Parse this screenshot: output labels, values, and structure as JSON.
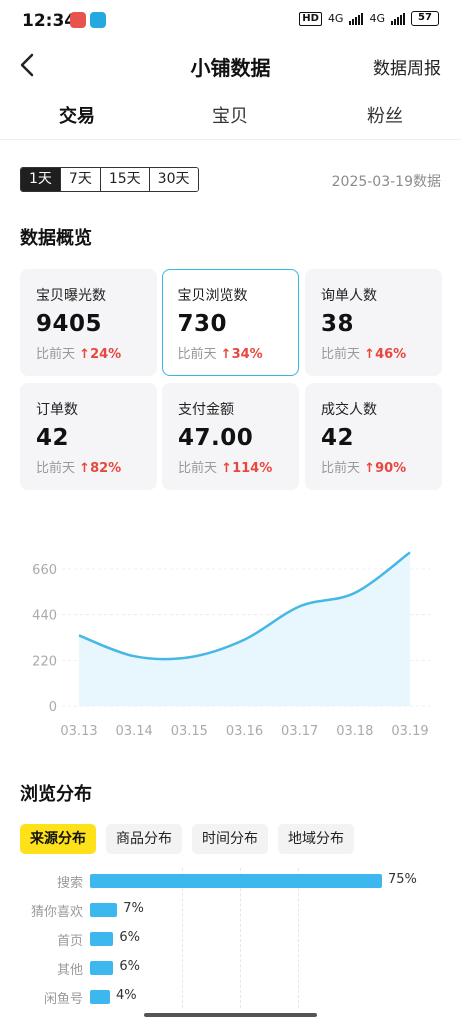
{
  "status": {
    "time": "12:34",
    "hd": "HD",
    "net1": "4G",
    "net2": "4G",
    "battery": "57"
  },
  "nav": {
    "title": "小铺数据",
    "right_link": "数据周报"
  },
  "tabs": [
    {
      "label": "交易",
      "active": true
    },
    {
      "label": "宝贝",
      "active": false
    },
    {
      "label": "粉丝",
      "active": false
    }
  ],
  "range": {
    "options": [
      "1天",
      "7天",
      "15天",
      "30天"
    ],
    "selected": "1天",
    "date_label": "2025-03-19数据"
  },
  "overview": {
    "title": "数据概览",
    "cards": [
      {
        "label": "宝贝曝光数",
        "value": "9405",
        "change_prefix": "比前天",
        "change": "24%"
      },
      {
        "label": "宝贝浏览数",
        "value": "730",
        "change_prefix": "比前天",
        "change": "34%"
      },
      {
        "label": "询单人数",
        "value": "38",
        "change_prefix": "比前天",
        "change": "46%"
      },
      {
        "label": "订单数",
        "value": "42",
        "change_prefix": "比前天",
        "change": "82%"
      },
      {
        "label": "支付金额",
        "value": "47.00",
        "change_prefix": "比前天",
        "change": "114%"
      },
      {
        "label": "成交人数",
        "value": "42",
        "change_prefix": "比前天",
        "change": "90%"
      }
    ],
    "selected_card": "宝贝浏览数"
  },
  "chart_data": {
    "type": "area",
    "x": [
      "03.13",
      "03.14",
      "03.15",
      "03.16",
      "03.17",
      "03.18",
      "03.19"
    ],
    "series": [
      {
        "values": [
          340,
          240,
          235,
          320,
          480,
          545,
          740
        ]
      }
    ],
    "ylim": [
      0,
      660
    ],
    "yticks": [
      0,
      220,
      440,
      660
    ],
    "grid": true,
    "line_color": "#45b8e5",
    "fill_color": "#e8f6fd"
  },
  "browse": {
    "title": "浏览分布",
    "subtabs": [
      {
        "label": "来源分布",
        "active": true
      },
      {
        "label": "商品分布",
        "active": false
      },
      {
        "label": "时间分布",
        "active": false
      },
      {
        "label": "地域分布",
        "active": false
      }
    ],
    "rows": [
      {
        "label": "搜索",
        "percent": 75,
        "text": "75%"
      },
      {
        "label": "猜你喜欢",
        "percent": 7,
        "text": "7%"
      },
      {
        "label": "首页",
        "percent": 6,
        "text": "6%"
      },
      {
        "label": "其他",
        "percent": 6,
        "text": "6%"
      },
      {
        "label": "闲鱼号",
        "percent": 4,
        "text": "4%"
      }
    ]
  },
  "colors": {
    "accent": "#ffe11a",
    "up": "#e8473f",
    "bar": "#3cb8ef",
    "active_border": "#34b7e0"
  }
}
